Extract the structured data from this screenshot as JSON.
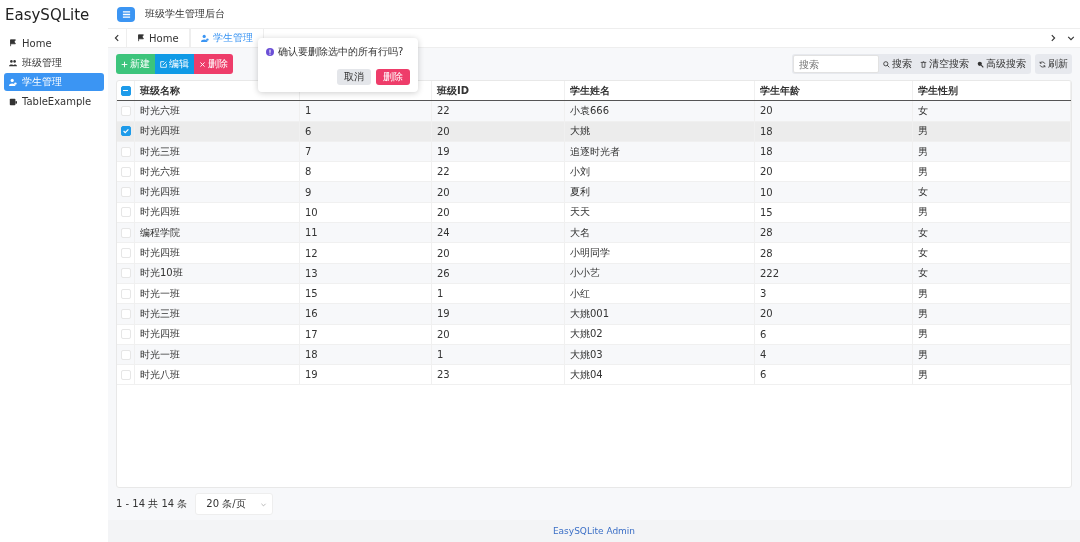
{
  "app_title": "EasySQLite",
  "sidebar": {
    "items": [
      {
        "label": "Home",
        "selected": false
      },
      {
        "label": "班级管理",
        "selected": false
      },
      {
        "label": "学生管理",
        "selected": true
      },
      {
        "label": "TableExample",
        "selected": false
      }
    ]
  },
  "header": {
    "title": "班级学生管理后台"
  },
  "tabs": [
    {
      "label": "Home",
      "selected": false
    },
    {
      "label": "学生管理",
      "selected": true
    }
  ],
  "toolbar": {
    "actions": [
      {
        "label": "新建",
        "kind": "add"
      },
      {
        "label": "编辑",
        "kind": "edit"
      },
      {
        "label": "删除",
        "kind": "delete"
      }
    ],
    "search": {
      "placeholder": "搜索"
    },
    "search_actions": [
      {
        "label": "搜索",
        "kind": "search"
      },
      {
        "label": "清空搜索",
        "kind": "clear"
      },
      {
        "label": "高级搜索",
        "kind": "advanced"
      }
    ],
    "refresh": "刷新"
  },
  "popconfirm": {
    "message": "确认要删除选中的所有行吗?",
    "cancel": "取消",
    "confirm": "删除"
  },
  "table": {
    "select_all_indeterminate": true,
    "columns": [
      {
        "label": "班级名称"
      },
      {},
      {
        "label": "班级ID"
      },
      {
        "label": "学生姓名"
      },
      {
        "label": "学生年龄"
      },
      {
        "label": "学生性别"
      }
    ],
    "rows": [
      {
        "selected": false,
        "cells": [
          "时光六班",
          "1",
          "22",
          "小袁666",
          "20",
          "女"
        ]
      },
      {
        "selected": true,
        "cells": [
          "时光四班",
          "6",
          "20",
          "大姚",
          "18",
          "男"
        ]
      },
      {
        "selected": false,
        "cells": [
          "时光三班",
          "7",
          "19",
          "追逐时光者",
          "18",
          "男"
        ]
      },
      {
        "selected": false,
        "cells": [
          "时光六班",
          "8",
          "22",
          "小刘",
          "20",
          "男"
        ]
      },
      {
        "selected": false,
        "cells": [
          "时光四班",
          "9",
          "20",
          "夏利",
          "10",
          "女"
        ]
      },
      {
        "selected": false,
        "cells": [
          "时光四班",
          "10",
          "20",
          "天天",
          "15",
          "男"
        ]
      },
      {
        "selected": false,
        "cells": [
          "编程学院",
          "11",
          "24",
          "大名",
          "28",
          "女"
        ]
      },
      {
        "selected": false,
        "cells": [
          "时光四班",
          "12",
          "20",
          "小明同学",
          "28",
          "女"
        ]
      },
      {
        "selected": false,
        "cells": [
          "时光10班",
          "13",
          "26",
          "小小艺",
          "222",
          "女"
        ]
      },
      {
        "selected": false,
        "cells": [
          "时光一班",
          "15",
          "1",
          "小红",
          "3",
          "男"
        ]
      },
      {
        "selected": false,
        "cells": [
          "时光三班",
          "16",
          "19",
          "大姚001",
          "20",
          "男"
        ]
      },
      {
        "selected": false,
        "cells": [
          "时光四班",
          "17",
          "20",
          "大姚02",
          "6",
          "男"
        ]
      },
      {
        "selected": false,
        "cells": [
          "时光一班",
          "18",
          "1",
          "大姚03",
          "4",
          "男"
        ]
      },
      {
        "selected": false,
        "cells": [
          "时光八班",
          "19",
          "23",
          "大姚04",
          "6",
          "男"
        ]
      }
    ]
  },
  "pagination": {
    "summary": "1 - 14 共 14 条",
    "page_size": "20 条/页"
  },
  "footer": "EasySQLite Admin"
}
